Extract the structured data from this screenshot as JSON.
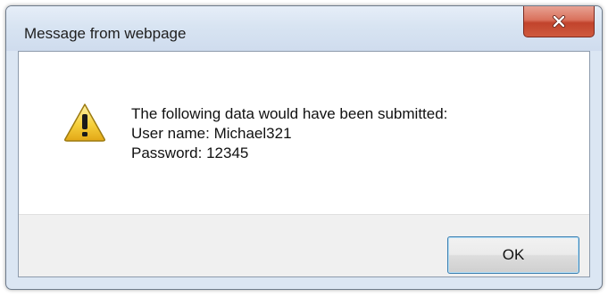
{
  "window": {
    "title": "Message from webpage",
    "close_icon": "close-icon"
  },
  "message": {
    "icon": "warning-icon",
    "lines": [
      "The following data would have been submitted:",
      "User name: Michael321",
      "Password: 12345"
    ]
  },
  "buttons": {
    "ok_label": "OK"
  },
  "colors": {
    "close_button": "#c1432c",
    "warning_triangle": "#f4c430",
    "ok_border": "#3c7fb1"
  }
}
